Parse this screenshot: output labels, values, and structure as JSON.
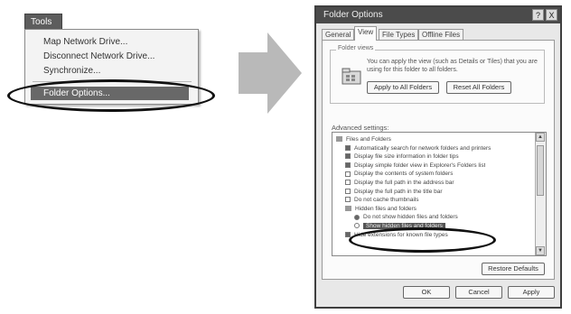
{
  "tools_menu": {
    "title": "Tools",
    "items": [
      {
        "label": "Map Network Drive..."
      },
      {
        "label": "Disconnect Network Drive..."
      },
      {
        "label": "Synchronize..."
      },
      {
        "label": "Folder Options..."
      }
    ]
  },
  "dialog": {
    "title": "Folder Options",
    "title_buttons": [
      "?",
      "X"
    ],
    "tabs": [
      {
        "label": "General"
      },
      {
        "label": "View"
      },
      {
        "label": "File Types"
      },
      {
        "label": "Offline Files"
      }
    ],
    "folder_views": {
      "legend": "Folder views",
      "description": "You can apply the view (such as Details or Tiles) that you are using for this folder to all folders.",
      "apply_label": "Apply to All Folders",
      "reset_label": "Reset All Folders"
    },
    "advanced_label": "Advanced settings:",
    "advanced_items": [
      {
        "label": "Files and Folders",
        "kind": "folder",
        "level": 0,
        "checked": false
      },
      {
        "label": "Automatically search for network folders and printers",
        "kind": "check",
        "level": 1,
        "checked": true
      },
      {
        "label": "Display file size information in folder tips",
        "kind": "check",
        "level": 1,
        "checked": true
      },
      {
        "label": "Display simple folder view in Explorer's Folders list",
        "kind": "check",
        "level": 1,
        "checked": true
      },
      {
        "label": "Display the contents of system folders",
        "kind": "check",
        "level": 1,
        "checked": false
      },
      {
        "label": "Display the full path in the address bar",
        "kind": "check",
        "level": 1,
        "checked": false
      },
      {
        "label": "Display the full path in the title bar",
        "kind": "check",
        "level": 1,
        "checked": false
      },
      {
        "label": "Do not cache thumbnails",
        "kind": "check",
        "level": 1,
        "checked": false
      },
      {
        "label": "Hidden files and folders",
        "kind": "folder",
        "level": 1,
        "checked": false
      },
      {
        "label": "Do not show hidden files and folders",
        "kind": "radio",
        "level": 2,
        "checked": true
      },
      {
        "label": "Show hidden files and folders",
        "kind": "radio",
        "level": 2,
        "checked": false,
        "selected": true
      },
      {
        "label": "Hide extensions for known file types",
        "kind": "check",
        "level": 1,
        "checked": true
      }
    ],
    "restore_defaults_label": "Restore Defaults",
    "ok_label": "OK",
    "cancel_label": "Cancel",
    "apply_label": "Apply"
  }
}
